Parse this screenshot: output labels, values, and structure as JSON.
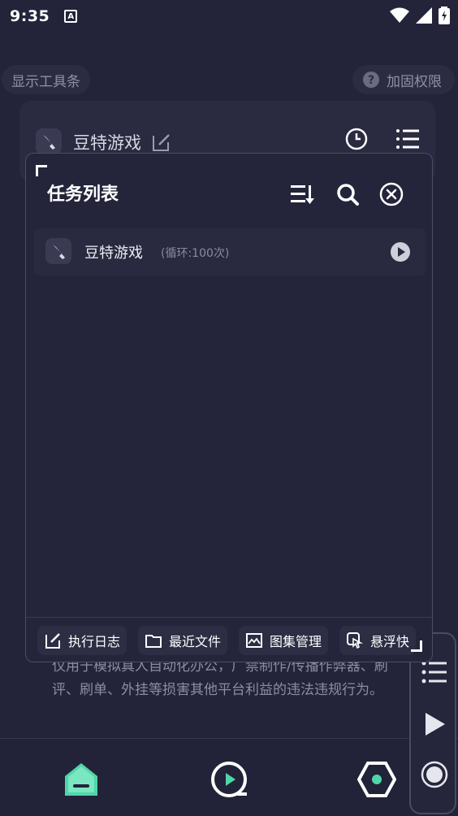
{
  "status_bar": {
    "time": "9:35",
    "badge": "A"
  },
  "background": {
    "show_toolbar_label": "显示工具条",
    "harden_permission_label": "加固权限",
    "task_title": "豆特游戏",
    "notice_text": "仅用于模拟真人自动化办公，广禁制作/传播作弊器、刷评、刷单、外挂等损害其他平台利益的违法违规行为。"
  },
  "panel": {
    "title": "任务列表",
    "tasks": [
      {
        "name": "豆特游戏",
        "loop": "(循环:100次)"
      }
    ],
    "footer": {
      "log_label": "执行日志",
      "recent_files_label": "最近文件",
      "gallery_label": "图集管理",
      "float_label": "悬浮快"
    }
  },
  "colors": {
    "accent_green": "#4fd6a8",
    "background": "#23233a",
    "panel": "#24243a"
  }
}
